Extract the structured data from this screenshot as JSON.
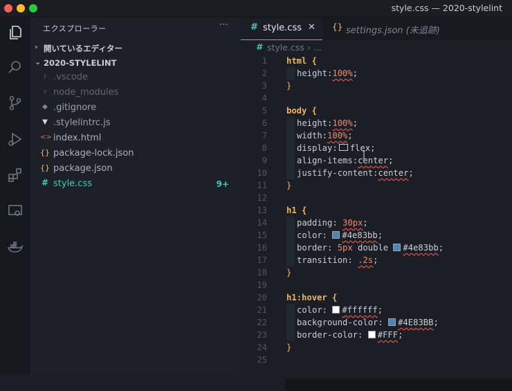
{
  "window": {
    "title": "style.css — 2020-stylelint"
  },
  "activity": [
    "explorer-icon",
    "search-icon",
    "source-control-icon",
    "run-debug-icon",
    "extensions-icon",
    "remote-explorer-icon",
    "docker-icon"
  ],
  "sidebar": {
    "header": "エクスプローラー",
    "more": "···",
    "open_editors": "開いているエディター",
    "project": "2020-STYLELINT",
    "items": [
      {
        "name": ".vscode",
        "icon": "›",
        "dim": true
      },
      {
        "name": "node_modules",
        "icon": "›",
        "dim": true
      },
      {
        "name": ".gitignore",
        "icon": "◆"
      },
      {
        "name": ".stylelintrc.js",
        "icon": "▼"
      },
      {
        "name": "index.html",
        "icon": "<>"
      },
      {
        "name": "package-lock.json",
        "icon": "{}"
      },
      {
        "name": "package.json",
        "icon": "{}"
      },
      {
        "name": "style.css",
        "icon": "#",
        "badge": "9+"
      }
    ]
  },
  "tabs": [
    {
      "label": "style.css",
      "close": "✕"
    },
    {
      "label": "settings.json (未追跡)"
    }
  ],
  "breadcrumb": "style.css › ...",
  "colors": {
    "accent": "#3ec9b8",
    "selector": "#f0b45c",
    "number": "#f08a6c",
    "error": "#d9534f"
  },
  "code": {
    "line_numbers": [
      "1",
      "2",
      "3",
      "4",
      "5",
      "6",
      "7",
      "8",
      "9",
      "10",
      "11",
      "12",
      "13",
      "14",
      "15",
      "16",
      "17",
      "18",
      "19",
      "20",
      "21",
      "22",
      "23",
      "24",
      "25"
    ],
    "selectors": {
      "html": "html {",
      "body": "body {",
      "h1": "h1 {",
      "h1hover_a": "h1",
      "h1hover_b": ":hover {"
    },
    "close": "}",
    "decls": {
      "l2": [
        "height:",
        "100%",
        ";"
      ],
      "l6": [
        "height:",
        "100%",
        ";"
      ],
      "l7": [
        "width:",
        "100%",
        ";"
      ],
      "l8": [
        "display:",
        "flex",
        ";"
      ],
      "l9": [
        "align-items:",
        "center",
        ";"
      ],
      "l10": [
        "justify-content:",
        "center",
        ";"
      ],
      "l14": [
        "padding: ",
        "30px",
        ";"
      ],
      "l15": [
        "color: ",
        "#4e83bb",
        ";"
      ],
      "l16": [
        "border: ",
        "5px",
        " double ",
        "#4e83bb",
        ";"
      ],
      "l17": [
        "transition: ",
        ".2s",
        ";"
      ],
      "l21": [
        "color: ",
        "#ffffff",
        ";"
      ],
      "l22": [
        "background-color: ",
        "#4E83BB",
        ";"
      ],
      "l23": [
        "border-color: ",
        "#FFF",
        ";"
      ]
    },
    "swatches": {
      "blue": "#4e83bb",
      "white": "#ffffff"
    }
  }
}
